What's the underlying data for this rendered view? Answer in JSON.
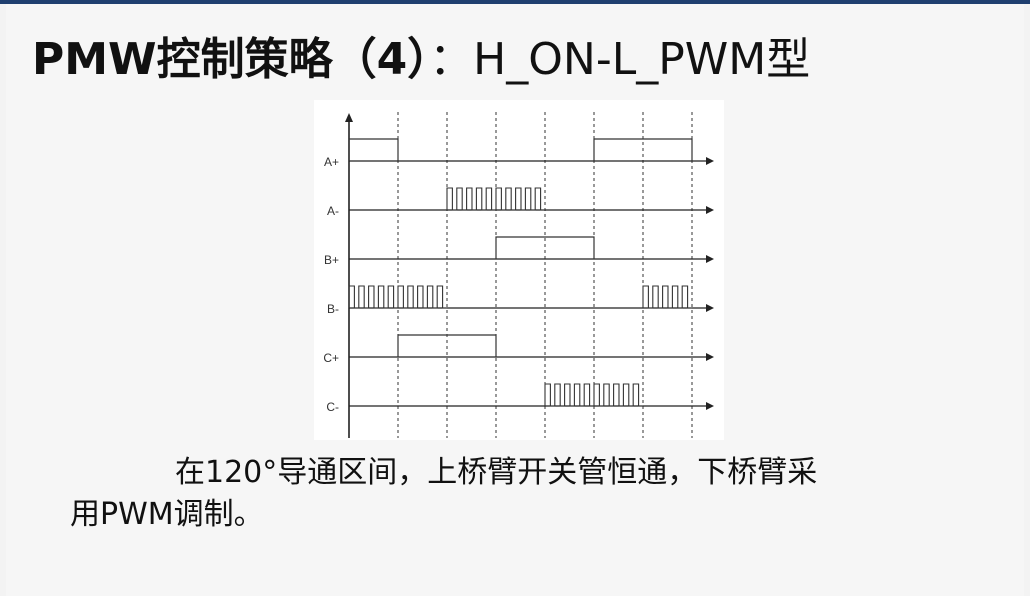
{
  "slide": {
    "title_bold": "PMW控制策略（4）",
    "title_normal": "：H_ON-L_PWM型"
  },
  "diagram": {
    "signals": [
      {
        "label": "A+",
        "high": [
          [
            0,
            1
          ],
          [
            5,
            7
          ]
        ],
        "mode": "on"
      },
      {
        "label": "A-",
        "high": [
          [
            2,
            4
          ]
        ],
        "mode": "pwm"
      },
      {
        "label": "B+",
        "high": [
          [
            3,
            5
          ]
        ],
        "mode": "on"
      },
      {
        "label": "B-",
        "high": [
          [
            0,
            2
          ],
          [
            6,
            7
          ]
        ],
        "mode": "pwm"
      },
      {
        "label": "C+",
        "high": [
          [
            1,
            3
          ]
        ],
        "mode": "on"
      },
      {
        "label": "C-",
        "high": [
          [
            4,
            6
          ]
        ],
        "mode": "pwm"
      }
    ]
  },
  "caption": {
    "line1": "在120°导通区间，上桥臂开关管恒通，下桥臂采",
    "line2": "用PWM调制。"
  }
}
